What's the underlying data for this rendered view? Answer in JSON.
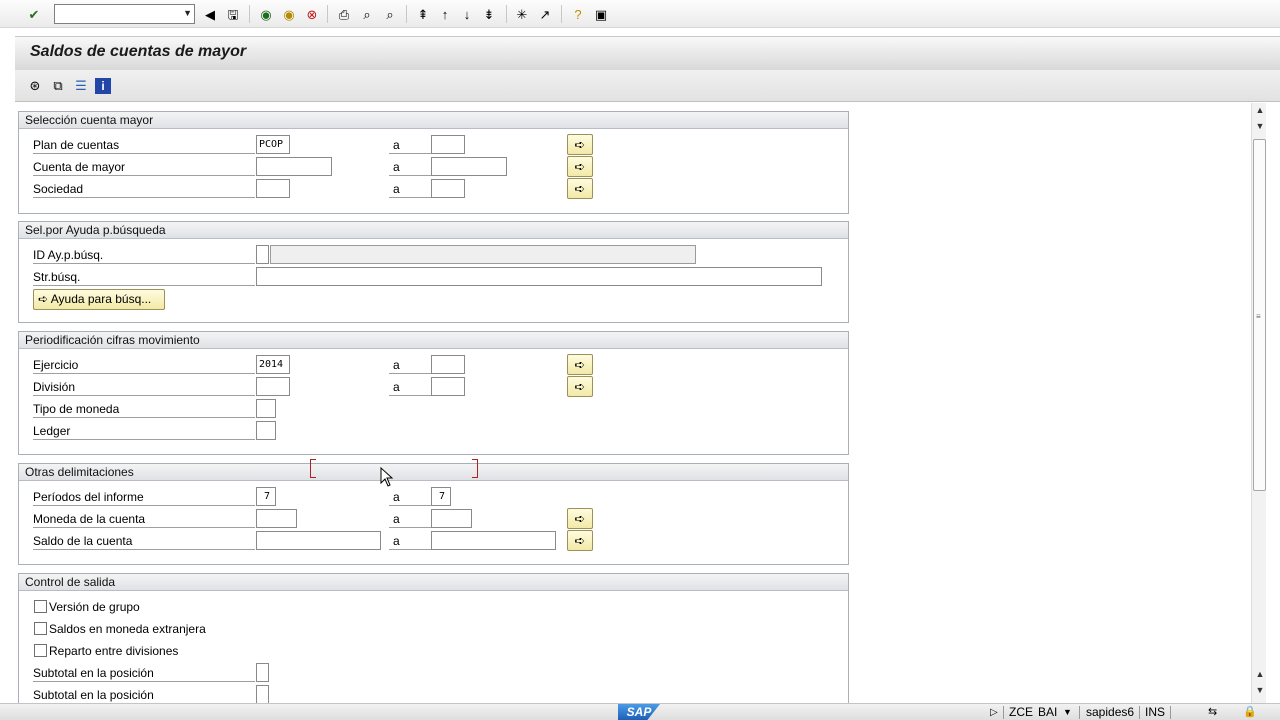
{
  "toolbar": {
    "enter_icon": "enter-check-icon",
    "command_placeholder": ""
  },
  "title": "Saldos de cuentas de mayor",
  "groups": {
    "seleccion": {
      "header": "Selección cuenta mayor",
      "rows": [
        {
          "label": "Plan de cuentas",
          "from": "PCOP",
          "to_label": "a",
          "to": ""
        },
        {
          "label": "Cuenta de mayor",
          "from": "",
          "to_label": "a",
          "to": ""
        },
        {
          "label": "Sociedad",
          "from": "",
          "to_label": "a",
          "to": ""
        }
      ]
    },
    "ayuda": {
      "header": "Sel.por Ayuda p.búsqueda",
      "id_label": "ID Ay.p.búsq.",
      "id_value": "",
      "str_label": "Str.búsq.",
      "str_value": "",
      "button_label": "Ayuda para búsq..."
    },
    "periodificacion": {
      "header": "Periodificación cifras movimiento",
      "ejercicio_label": "Ejercicio",
      "ejercicio_from": "2014",
      "division_label": "División",
      "tipo_label": "Tipo de moneda",
      "ledger_label": "Ledger",
      "a": "a"
    },
    "otras": {
      "header": "Otras delimitaciones",
      "periodos_label": "Períodos del informe",
      "periodos_from": "7",
      "periodos_to": "7",
      "moneda_label": "Moneda de la cuenta",
      "saldo_label": "Saldo de la cuenta",
      "a": "a"
    },
    "control": {
      "header": "Control de salida",
      "checks": [
        "Versión de grupo",
        "Saldos en moneda extranjera",
        "Reparto entre divisiones"
      ],
      "subtotal1": "Subtotal en la posición",
      "subtotal2": "Subtotal en la posición"
    }
  },
  "status": {
    "system": "ZCE",
    "client": "BAI",
    "server": "sapides6",
    "mode": "INS",
    "logo": "SAP"
  }
}
